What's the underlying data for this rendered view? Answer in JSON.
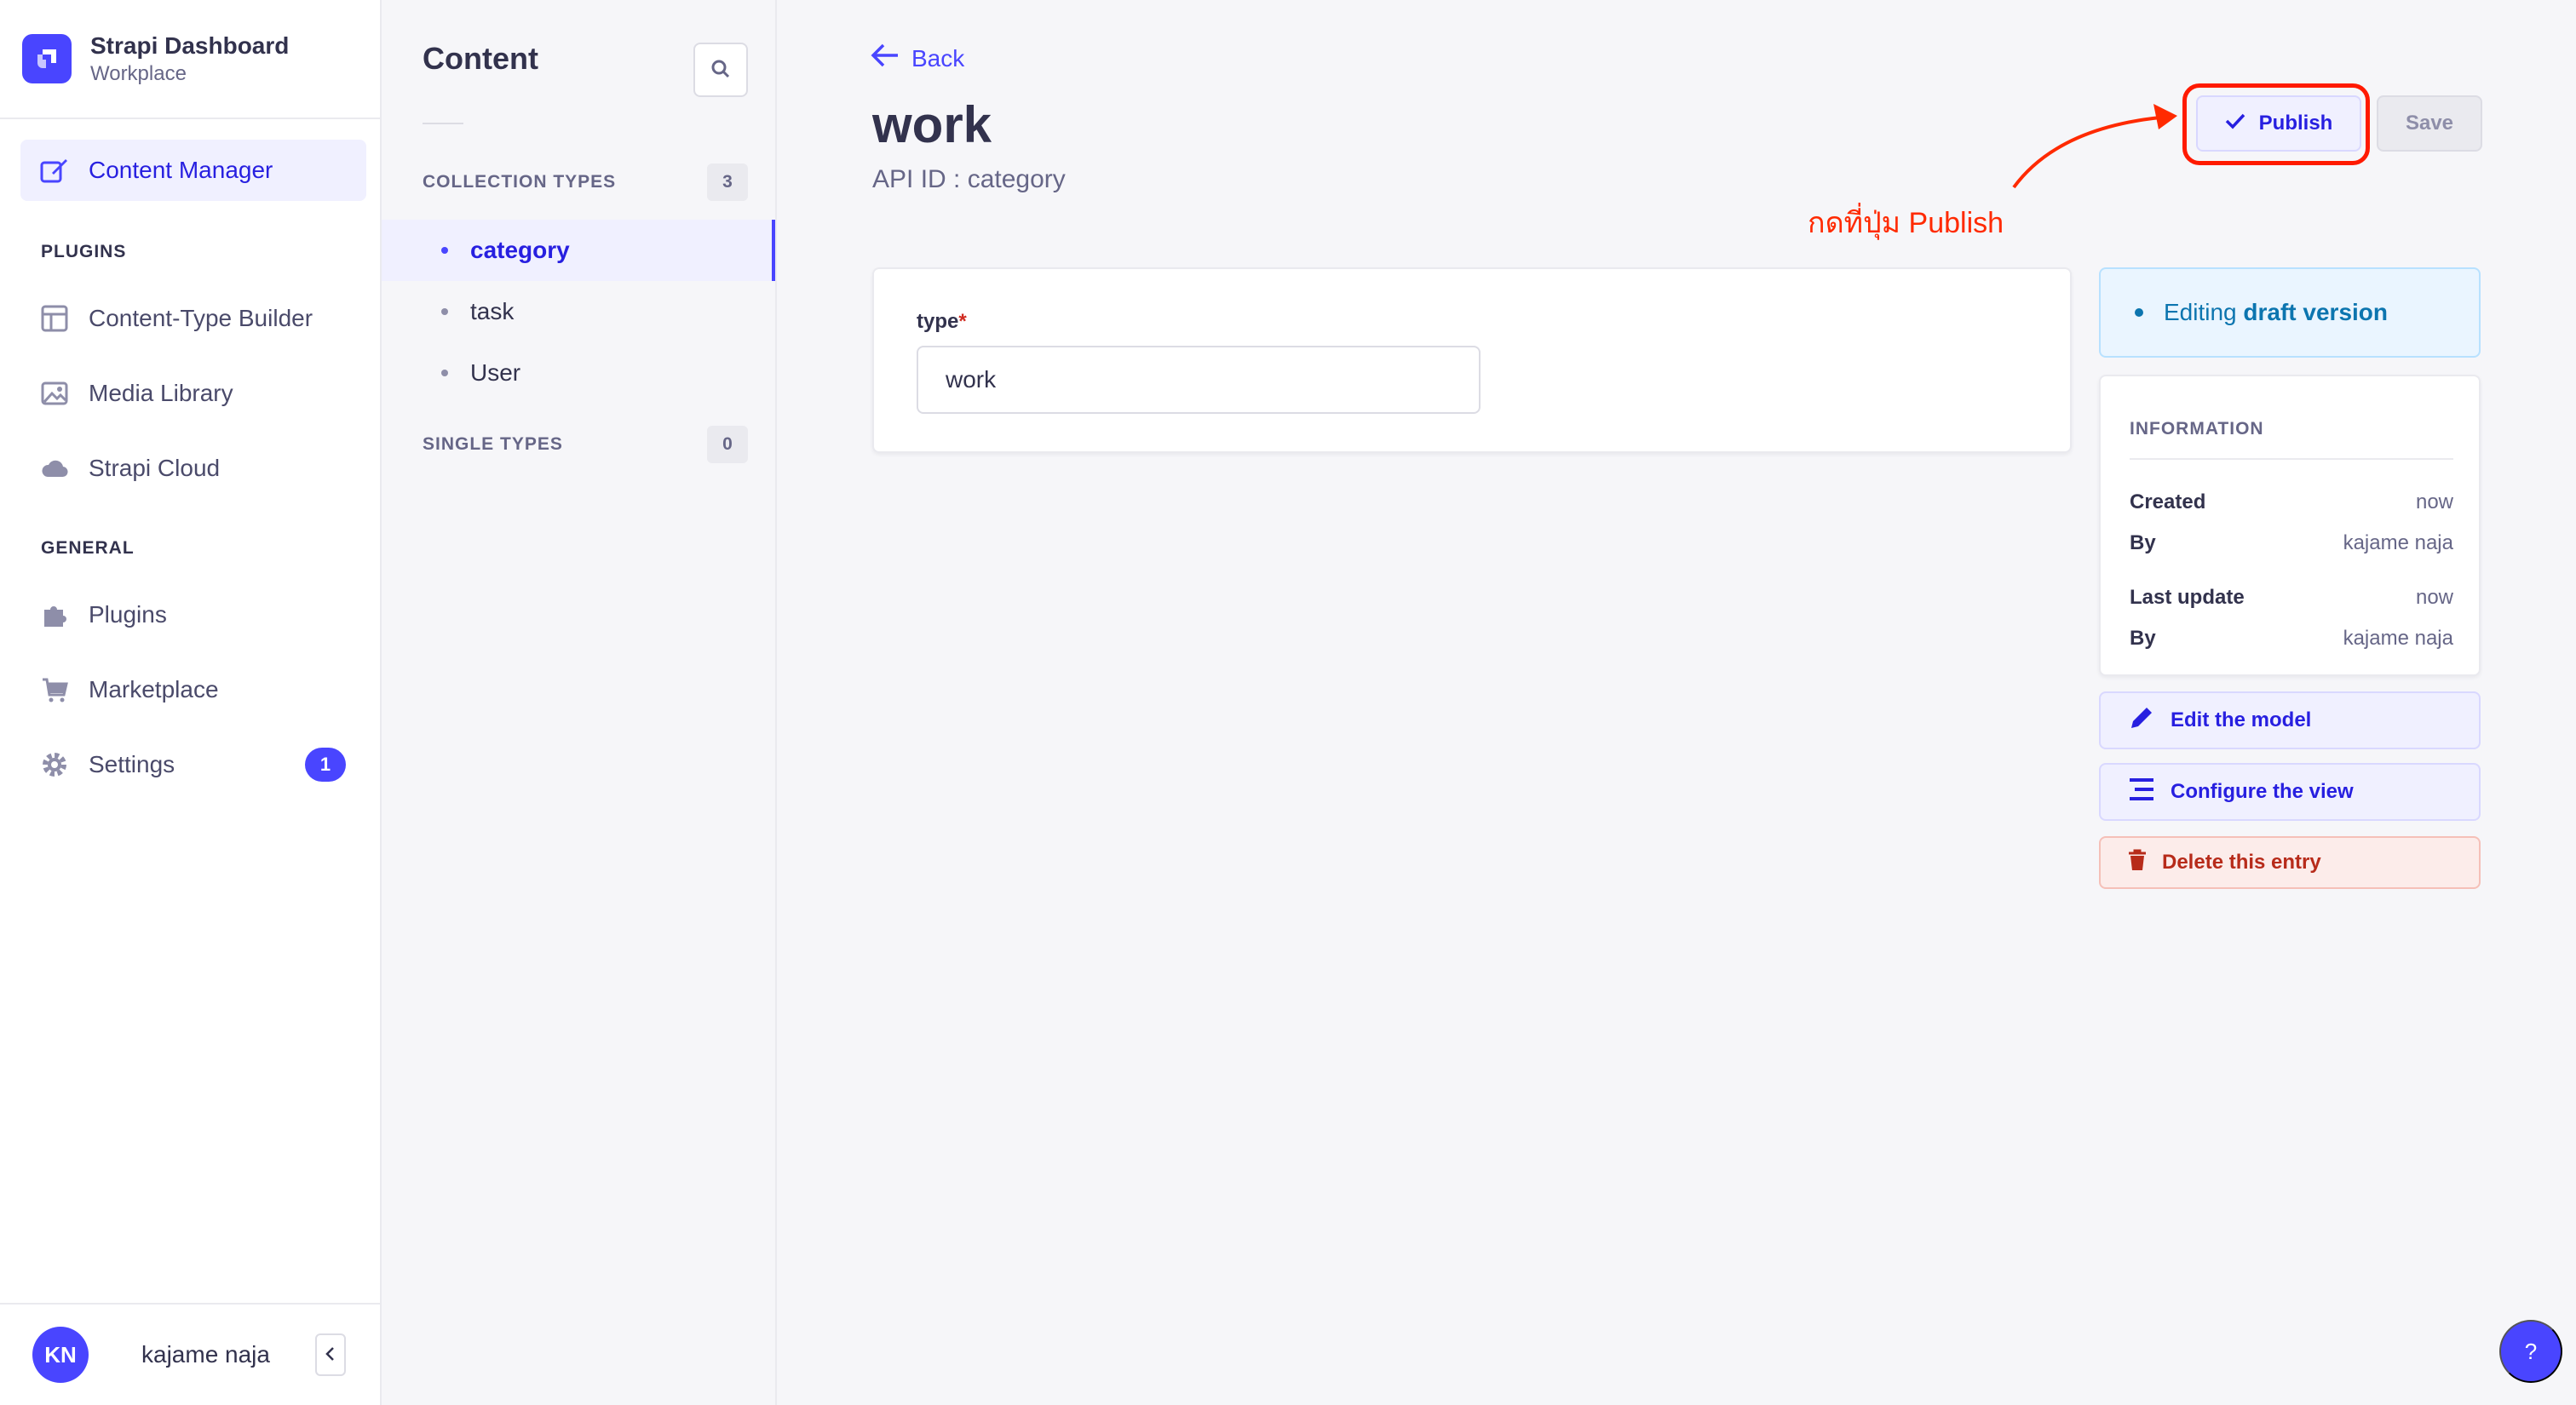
{
  "brand": {
    "title": "Strapi Dashboard",
    "subtitle": "Workplace"
  },
  "mainnav": {
    "content_manager": "Content Manager",
    "plugins_section": "PLUGINS",
    "content_type_builder": "Content-Type Builder",
    "media_library": "Media Library",
    "strapi_cloud": "Strapi Cloud",
    "general_section": "GENERAL",
    "plugins": "Plugins",
    "marketplace": "Marketplace",
    "settings": "Settings",
    "settings_badge": "1"
  },
  "user": {
    "initials": "KN",
    "name": "kajame naja"
  },
  "subnav": {
    "title": "Content",
    "collection_types": "COLLECTION TYPES",
    "collection_count": "3",
    "items": [
      "category",
      "task",
      "User"
    ],
    "single_types": "SINGLE TYPES",
    "single_count": "0"
  },
  "header": {
    "back": "Back",
    "title": "work",
    "api_id": "API ID : category",
    "publish": "Publish",
    "save": "Save"
  },
  "annotation": {
    "text": "กดที่ปุ่ม Publish",
    "color": "#ff2a00"
  },
  "form": {
    "field_label": "type",
    "required_mark": "*",
    "field_value": "work"
  },
  "draft": {
    "prefix": "Editing",
    "strong": "draft version"
  },
  "info": {
    "heading": "INFORMATION",
    "created_label": "Created",
    "created_value": "now",
    "by_label": "By",
    "created_by": "kajame naja",
    "updated_label": "Last update",
    "updated_value": "now",
    "updated_by": "kajame naja"
  },
  "actions": {
    "edit_model": "Edit the model",
    "configure_view": "Configure the view",
    "delete_entry": "Delete this entry"
  },
  "help": {
    "label": "?"
  },
  "colors": {
    "primary": "#4945ff",
    "primary_text": "#271fe0",
    "danger": "#b72b1a",
    "info": "#0c75af"
  }
}
